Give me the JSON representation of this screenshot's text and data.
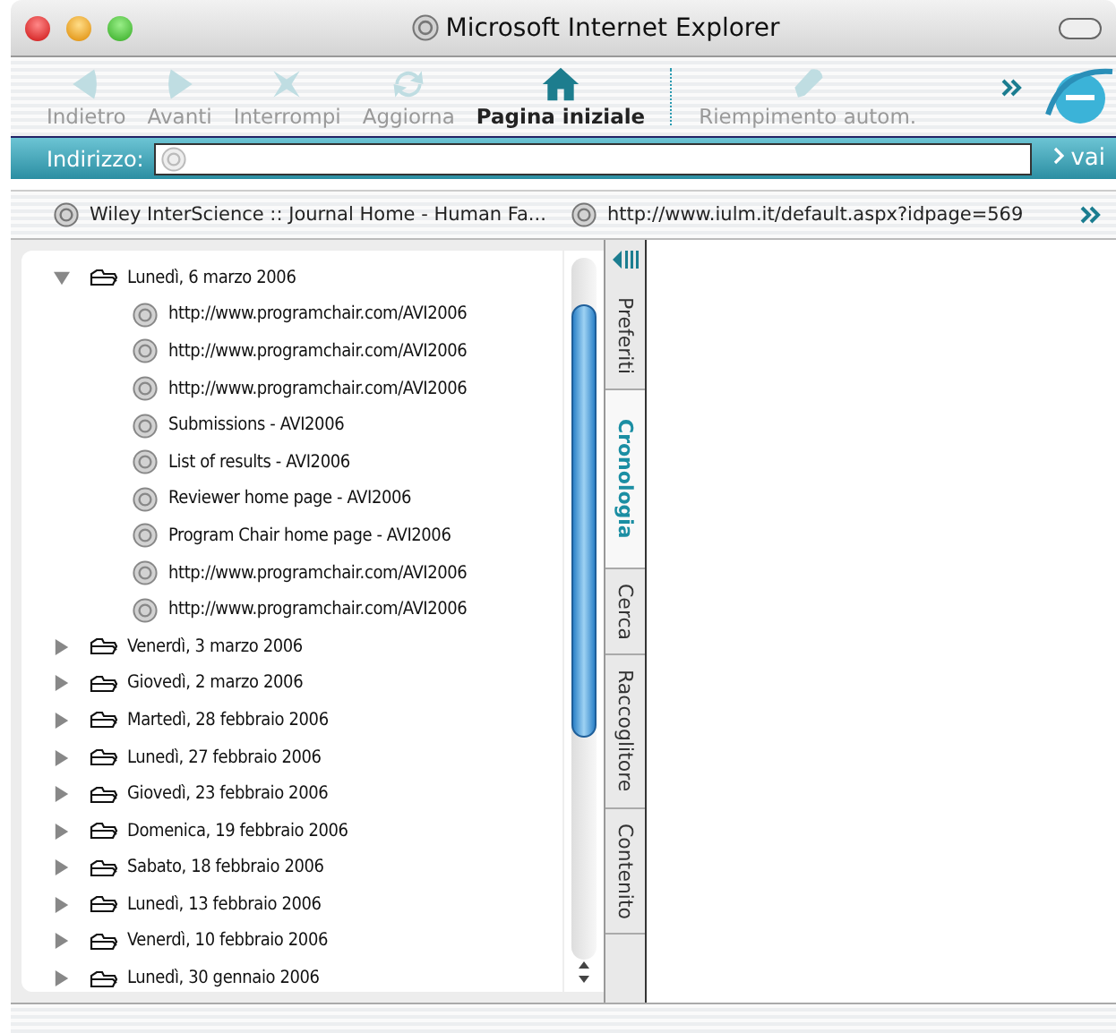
{
  "window": {
    "title": "Microsoft Internet Explorer"
  },
  "toolbar": [
    {
      "kind": "back",
      "label": "Indietro",
      "disabled": true
    },
    {
      "kind": "forward",
      "label": "Avanti",
      "disabled": true
    },
    {
      "kind": "stop",
      "label": "Interrompi",
      "disabled": true
    },
    {
      "kind": "refresh",
      "label": "Aggiorna",
      "disabled": true
    },
    {
      "kind": "home",
      "label": "Pagina iniziale",
      "disabled": false
    },
    {
      "kind": "autofill",
      "label": "Riempimento autom.",
      "disabled": true
    }
  ],
  "address_bar": {
    "label": "Indirizzo:",
    "go": "vai"
  },
  "favorites_bar": [
    "Wiley InterScience :: Journal Home - Human Fa...",
    "http://www.iulm.it/default.aspx?idpage=569"
  ],
  "history": [
    {
      "label": "Lunedì, 6 marzo 2006",
      "expanded": true,
      "children": [
        "http://www.programchair.com/AVI2006",
        "http://www.programchair.com/AVI2006",
        "http://www.programchair.com/AVI2006",
        "Submissions - AVI2006",
        "List of results - AVI2006",
        "Reviewer home page - AVI2006",
        "Program Chair home page - AVI2006",
        "http://www.programchair.com/AVI2006",
        "http://www.programchair.com/AVI2006"
      ]
    },
    {
      "label": "Venerdì, 3 marzo 2006",
      "expanded": false
    },
    {
      "label": "Giovedì, 2 marzo 2006",
      "expanded": false
    },
    {
      "label": "Martedì, 28 febbraio 2006",
      "expanded": false
    },
    {
      "label": "Lunedì, 27 febbraio 2006",
      "expanded": false
    },
    {
      "label": "Giovedì, 23 febbraio 2006",
      "expanded": false
    },
    {
      "label": "Domenica, 19 febbraio 2006",
      "expanded": false
    },
    {
      "label": "Sabato, 18 febbraio 2006",
      "expanded": false
    },
    {
      "label": "Lunedì, 13 febbraio 2006",
      "expanded": false
    },
    {
      "label": "Venerdì, 10 febbraio 2006",
      "expanded": false
    },
    {
      "label": "Lunedì, 30 gennaio 2006",
      "expanded": false
    }
  ],
  "sidebar_tabs": [
    {
      "label": "Preferiti",
      "selected": false
    },
    {
      "label": "Cronologia",
      "selected": true
    },
    {
      "label": "Cerca",
      "selected": false
    },
    {
      "label": "Raccoglitore",
      "selected": false
    },
    {
      "label": "Contenito",
      "selected": false
    }
  ]
}
